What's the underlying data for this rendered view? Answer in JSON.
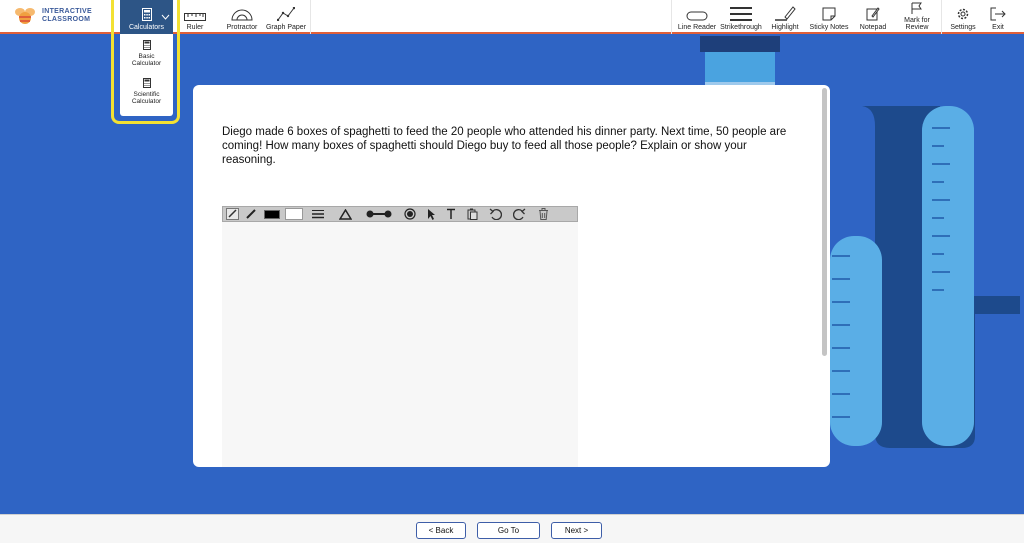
{
  "app": {
    "logo_line1": "INTERACTIVE",
    "logo_line2": "CLASSROOM"
  },
  "toolbar": {
    "left_tools": [
      {
        "label": "Calculators",
        "icon": "calculator-icon"
      },
      {
        "label": "Ruler",
        "icon": "ruler-icon"
      },
      {
        "label": "Protractor",
        "icon": "protractor-icon"
      },
      {
        "label": "Graph Paper",
        "icon": "graph-icon"
      }
    ],
    "right_tools": [
      {
        "label": "Line Reader",
        "icon": "line-reader-icon"
      },
      {
        "label": "Strikethrough",
        "icon": "strikethrough-icon"
      },
      {
        "label": "Highlight",
        "icon": "highlight-icon"
      },
      {
        "label": "Sticky Notes",
        "icon": "sticky-note-icon"
      },
      {
        "label": "Notepad",
        "icon": "notepad-icon"
      },
      {
        "label": "Mark for Review",
        "icon": "flag-icon"
      },
      {
        "label": "Settings",
        "icon": "gear-icon"
      },
      {
        "label": "Exit",
        "icon": "exit-icon"
      }
    ]
  },
  "calculators_menu": {
    "items": [
      {
        "label": "Basic Calculator",
        "icon": "calculator-icon"
      },
      {
        "label": "Scientific Calculator",
        "icon": "calculator-icon"
      }
    ]
  },
  "question": {
    "text": "Diego made 6 boxes of spaghetti to feed the 20 people who attended his dinner party. Next time, 50 people are coming! How many boxes of spaghetti should Diego buy to feed all those people? Explain or show your reasoning."
  },
  "drawing_tools": [
    "pencil-icon",
    "brush-icon",
    "stroke-color",
    "fill-color",
    "line-width-icon",
    "shape-icon",
    "line-segment-icon",
    "circle-icon",
    "select-icon",
    "text-icon",
    "paste-icon",
    "undo-icon",
    "redo-icon",
    "trash-icon"
  ],
  "colors": {
    "background": "#2f64c4",
    "toolbar_active": "#2d5586",
    "highlight_border": "#f3e132",
    "toolbar_underline": "#e0603a",
    "nav_border": "#3e5ea8"
  },
  "navigation": {
    "back": "< Back",
    "goto": "Go To",
    "next": "Next >"
  }
}
